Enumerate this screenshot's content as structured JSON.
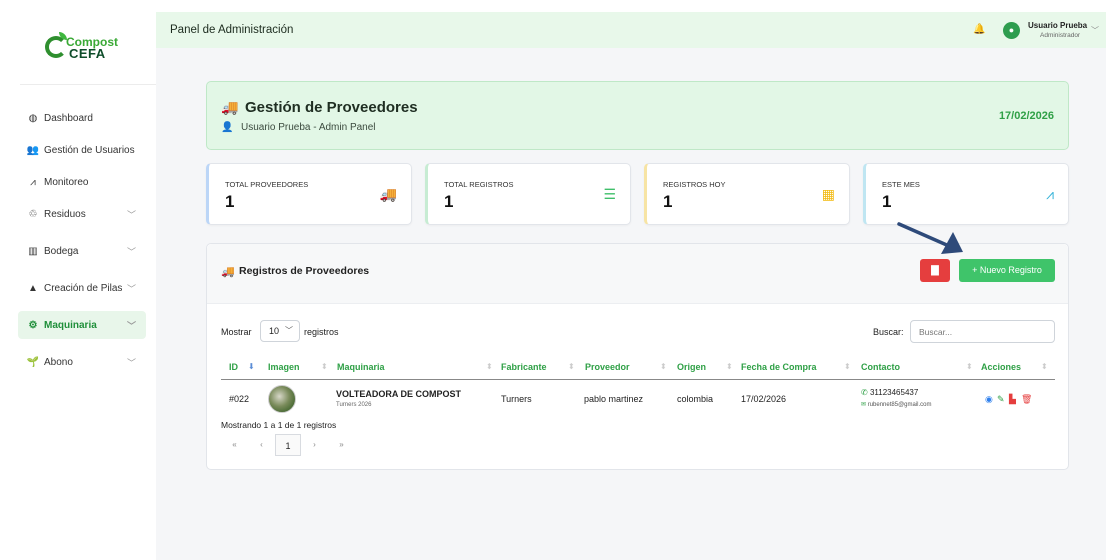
{
  "brand": {
    "line1": "Compost",
    "line2": "CEFA"
  },
  "sidebar": {
    "items": [
      {
        "label": "Dashboard",
        "icon": "globe-icon",
        "chevron": false
      },
      {
        "label": "Gestión de Usuarios",
        "icon": "users-icon",
        "chevron": false
      },
      {
        "label": "Monitoreo",
        "icon": "chart-line-icon",
        "chevron": false
      },
      {
        "label": "Residuos",
        "icon": "recycle-icon",
        "chevron": true
      },
      {
        "label": "Bodega",
        "icon": "warehouse-icon",
        "chevron": true
      },
      {
        "label": "Creación de Pilas",
        "icon": "mountain-icon",
        "chevron": true
      },
      {
        "label": "Maquinaria",
        "icon": "cogs-icon",
        "chevron": true,
        "active": true
      },
      {
        "label": "Abono",
        "icon": "seedling-icon",
        "chevron": true
      }
    ]
  },
  "topbar": {
    "title": "Panel de Administración",
    "user_name": "Usuario Prueba",
    "user_role": "Administrador"
  },
  "hero": {
    "title": "Gestión de Proveedores",
    "subtitle": "Usuario Prueba - Admin Panel",
    "date": "17/02/2026"
  },
  "stats": [
    {
      "label": "TOTAL PROVEEDORES",
      "value": "1",
      "icon": "truck-icon",
      "color": "#5b9bf0"
    },
    {
      "label": "TOTAL REGISTROS",
      "value": "1",
      "icon": "list-icon",
      "color": "#3fbf6a"
    },
    {
      "label": "REGISTROS HOY",
      "value": "1",
      "icon": "calendar-icon",
      "color": "#f2b90f"
    },
    {
      "label": "ESTE MES",
      "value": "1",
      "icon": "chart-area-icon",
      "color": "#39b4d9"
    }
  ],
  "table_card": {
    "title": "Registros de Proveedores",
    "new_button": "+ Nuevo Registro",
    "show_label": "Mostrar",
    "show_value": "10",
    "show_suffix": "registros",
    "search_label": "Buscar:",
    "search_placeholder": "Buscar...",
    "columns": [
      "ID",
      "Imagen",
      "Maquinaria",
      "Fabricante",
      "Proveedor",
      "Origen",
      "Fecha de Compra",
      "Contacto",
      "Acciones"
    ],
    "rows": [
      {
        "id": "#022",
        "machine": "VOLTEADORA DE COMPOST",
        "machine_sub": "Turners 2026",
        "maker": "Turners",
        "supplier": "pablo martinez",
        "origin": "colombia",
        "date": "17/02/2026",
        "phone": "31123465437",
        "email": "rubennet85@gmail.com"
      }
    ],
    "info": "Mostrando 1 a 1 de 1 registros",
    "pagination": {
      "first": "«",
      "prev": "‹",
      "current": "1",
      "next": "›",
      "last": "»"
    }
  },
  "colors": {
    "accent": "#2fa046",
    "danger": "#e53e3e",
    "primary_btn": "#3fc46a",
    "arrow": "#2e4a7a"
  }
}
